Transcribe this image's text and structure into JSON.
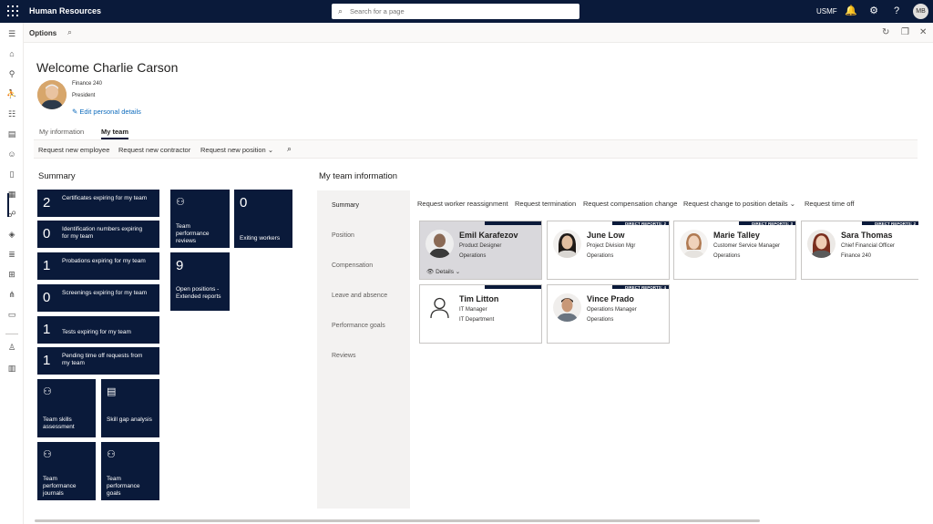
{
  "app": {
    "title": "Human Resources",
    "company": "USMF",
    "user_initials": "MB"
  },
  "search": {
    "placeholder": "Search for a page"
  },
  "actionbar": {
    "options_label": "Options"
  },
  "header": {
    "welcome": "Welcome Charlie Carson",
    "department": "Finance 240",
    "title": "President",
    "edit_link": "Edit personal details"
  },
  "tabs": [
    {
      "label": "My information"
    },
    {
      "label": "My team"
    }
  ],
  "requests": [
    "Request new employee",
    "Request new contractor",
    "Request new position"
  ],
  "summary": {
    "title": "Summary",
    "count_tiles": [
      {
        "count": "2",
        "label": "Certificates expiring for my team"
      },
      {
        "count": "0",
        "label": "Identification numbers expiring for my team"
      },
      {
        "count": "1",
        "label": "Probations expiring for my team"
      },
      {
        "count": "0",
        "label": "Screenings expiring for my team"
      },
      {
        "count": "1",
        "label": "Tests expiring for my team"
      },
      {
        "count": "1",
        "label": "Pending time off requests from my team"
      }
    ],
    "icon_tiles": [
      {
        "label": "Team skills assessment",
        "icon": "people-icon"
      },
      {
        "label": "Skill gap analysis",
        "icon": "report-icon"
      },
      {
        "label": "Team performance journals",
        "icon": "people-icon"
      },
      {
        "label": "Team performance goals",
        "icon": "people-icon"
      },
      {
        "label": "Team performance reviews",
        "icon": "people-icon"
      }
    ],
    "stat_tiles": [
      {
        "count": "0",
        "label": "Exiting workers"
      },
      {
        "count": "9",
        "label": "Open positions - Extended reports"
      }
    ]
  },
  "team": {
    "title": "My team information",
    "vertical_tabs": [
      "Summary",
      "Position",
      "Compensation",
      "Leave and absence",
      "Performance goals",
      "Reviews"
    ],
    "actions": [
      "Request worker reassignment",
      "Request termination",
      "Request compensation change",
      "Request change to position details",
      "Request time off"
    ],
    "cards": [
      {
        "name": "Emil Karafezov",
        "title": "Product Designer",
        "dept": "Operations",
        "direct_reports": "",
        "details": "Details"
      },
      {
        "name": "June Low",
        "title": "Project Division Mgr",
        "dept": "Operations",
        "direct_reports": "DIRECT REPORTS: 2"
      },
      {
        "name": "Marie Talley",
        "title": "Customer Service Manager",
        "dept": "Operations",
        "direct_reports": "DIRECT REPORTS: 3"
      },
      {
        "name": "Sara Thomas",
        "title": "Chief Financial Officer",
        "dept": "Finance 240",
        "direct_reports": "DIRECT REPORTS: 2"
      },
      {
        "name": "Tim Litton",
        "title": "IT Manager",
        "dept": "IT Department",
        "direct_reports": ""
      },
      {
        "name": "Vince Prado",
        "title": "Operations Manager",
        "dept": "Operations",
        "direct_reports": "DIRECT REPORTS: 4"
      }
    ]
  }
}
